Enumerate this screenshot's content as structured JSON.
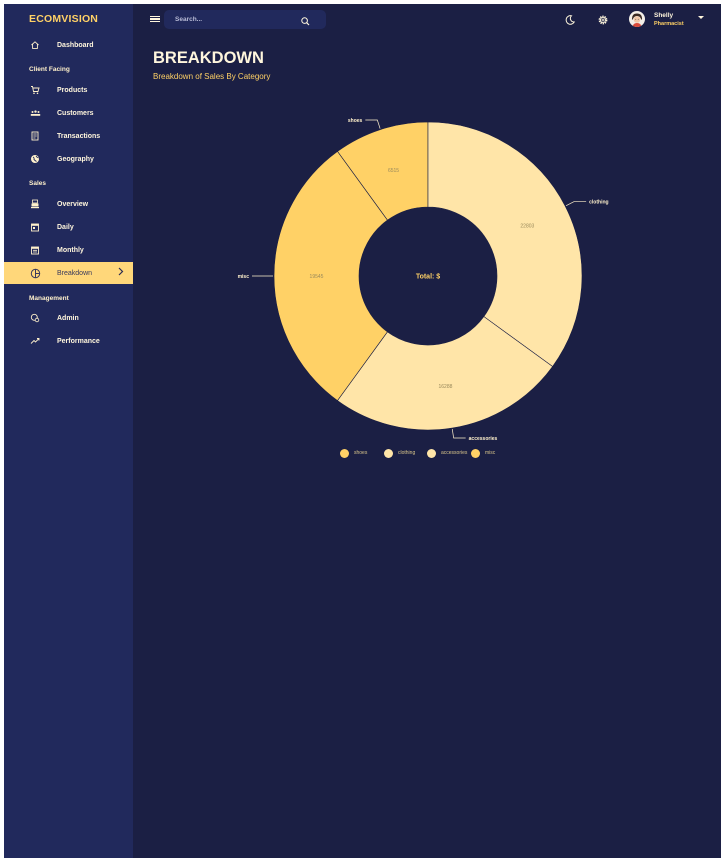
{
  "app": {
    "brand": "ECOMVISION"
  },
  "sidebar": {
    "items": [
      {
        "label": "Dashboard",
        "icon": "home-icon"
      },
      {
        "section": "Client Facing"
      },
      {
        "label": "Products",
        "icon": "cart-icon"
      },
      {
        "label": "Customers",
        "icon": "groups-icon"
      },
      {
        "label": "Transactions",
        "icon": "receipt-icon"
      },
      {
        "label": "Geography",
        "icon": "globe-icon"
      },
      {
        "section": "Sales"
      },
      {
        "label": "Overview",
        "icon": "point-of-sale-icon"
      },
      {
        "label": "Daily",
        "icon": "calendar-today-icon"
      },
      {
        "label": "Monthly",
        "icon": "calendar-month-icon"
      },
      {
        "label": "Breakdown",
        "icon": "pie-chart-icon",
        "active": true
      },
      {
        "section": "Management"
      },
      {
        "label": "Admin",
        "icon": "admin-icon"
      },
      {
        "label": "Performance",
        "icon": "trending-up-icon"
      }
    ]
  },
  "topbar": {
    "search_placeholder": "Search...",
    "user_name": "Shelly",
    "user_role": "Pharmacist"
  },
  "header": {
    "title": "BREAKDOWN",
    "subtitle": "Breakdown of Sales By Category"
  },
  "colors": {
    "background": "#1b1f44",
    "sidebar": "#21295c",
    "accent": "#ffd166",
    "slice_light": "#ffe5a8",
    "slice_dark": "#ffd166"
  },
  "chart_data": {
    "type": "pie",
    "donut": true,
    "categories": [
      "shoes",
      "clothing",
      "accessories",
      "misc"
    ],
    "values": [
      6515,
      22803,
      16288,
      19545
    ],
    "center_text": "Total: $",
    "legend_position": "bottom",
    "legend": [
      "shoes",
      "clothing",
      "accessories",
      "misc"
    ]
  }
}
